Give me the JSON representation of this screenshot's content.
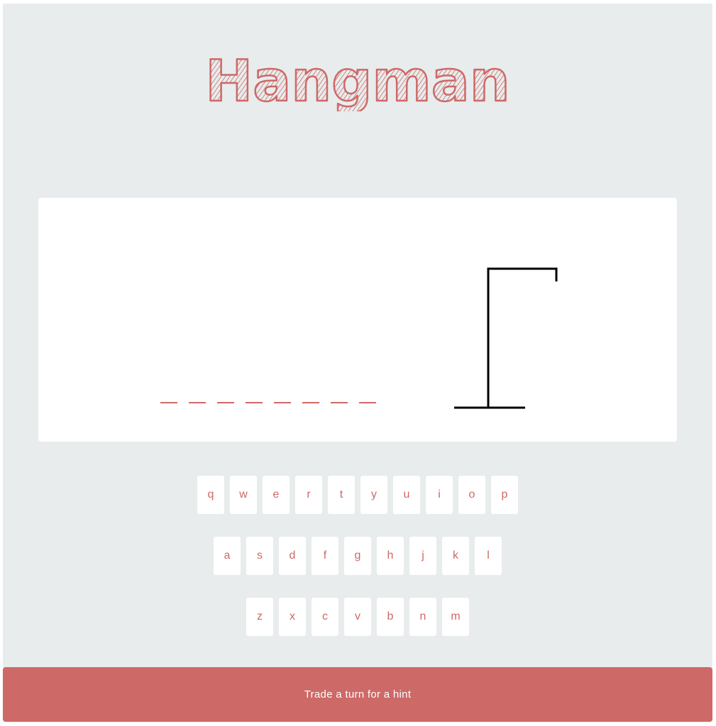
{
  "app": {
    "title": "Hangman",
    "accent_color": "#cd6967",
    "background_color": "#e8eced"
  },
  "word": {
    "letter_count": 8,
    "revealed": [
      "",
      "",
      "",
      "",
      "",
      "",
      "",
      ""
    ]
  },
  "gallows": {
    "stage": "empty gallows (base, pole, beam, rope)"
  },
  "keyboard": {
    "rows": [
      [
        "q",
        "w",
        "e",
        "r",
        "t",
        "y",
        "u",
        "i",
        "o",
        "p"
      ],
      [
        "a",
        "s",
        "d",
        "f",
        "g",
        "h",
        "j",
        "k",
        "l"
      ],
      [
        "z",
        "x",
        "c",
        "v",
        "b",
        "n",
        "m"
      ]
    ]
  },
  "hint_button": {
    "label": "Trade a turn for a hint"
  }
}
